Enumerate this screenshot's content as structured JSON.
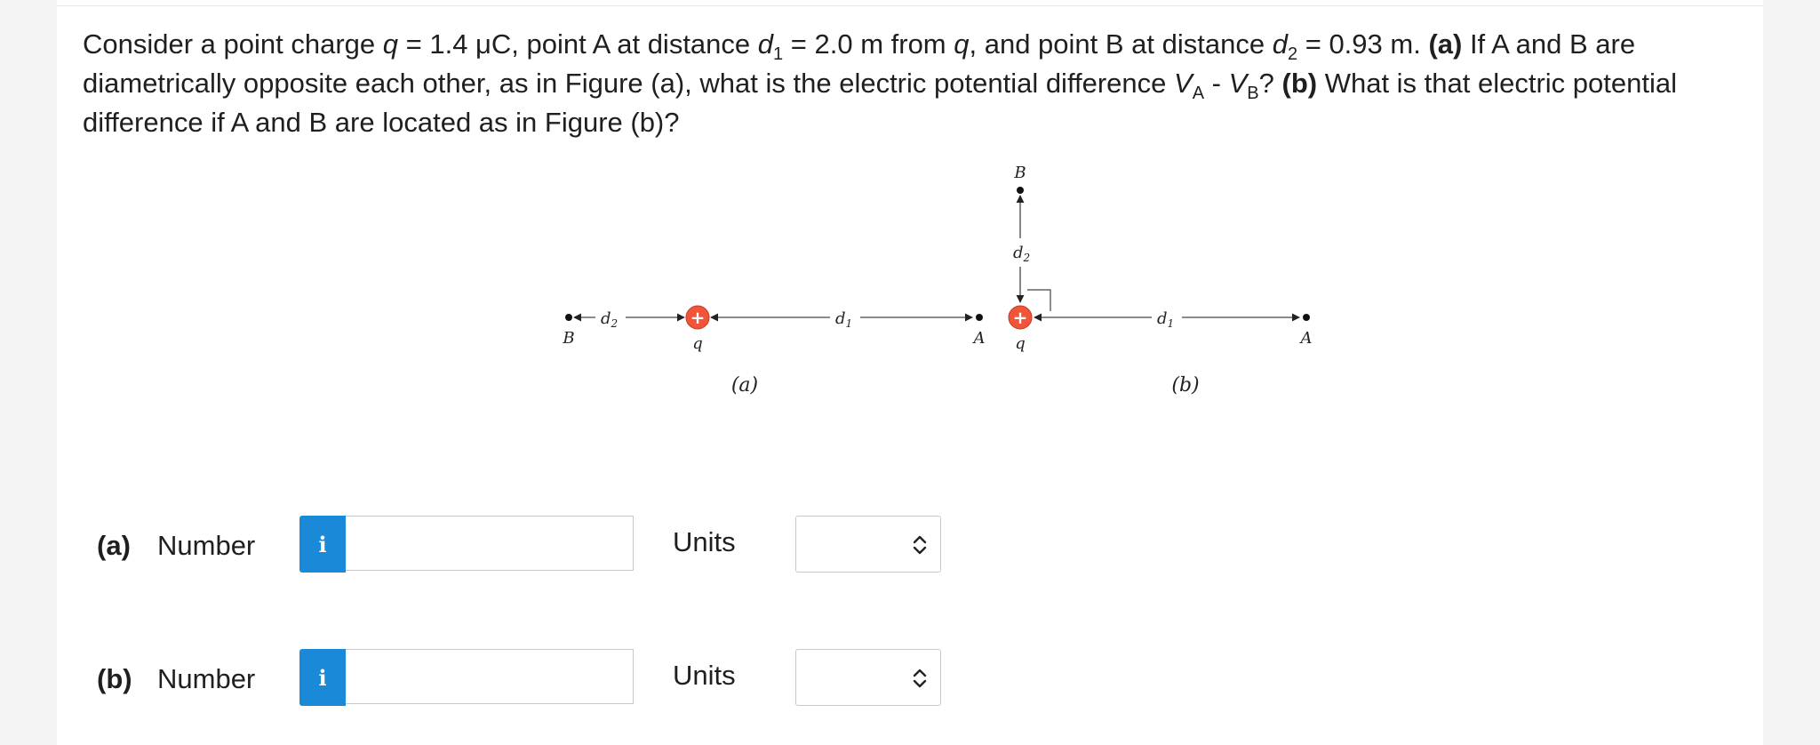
{
  "question": {
    "p1": "Consider a point charge ",
    "q_sym": "q",
    "p2": " = 1.4 μC, point A at distance ",
    "d1_sym": "d",
    "d1_sub": "1",
    "p3": " = 2.0 m from ",
    "q_sym2": "q",
    "p4": ", and point B at distance ",
    "d2_sym": "d",
    "d2_sub": "2",
    "p5": " = 0.93 m. ",
    "a_tag": "(a)",
    "p6": " If A and B are diametrically opposite each other, as in Figure (a), what is the electric potential difference ",
    "va_sym": "V",
    "va_sub": "A",
    "minus": " - ",
    "vb_sym": "V",
    "vb_sub": "B",
    "p7": "? ",
    "b_tag": "(b)",
    "p8": " What is that electric potential difference if A and B are located as in Figure (b)?"
  },
  "figure": {
    "a": {
      "label_B": "B",
      "label_d2": "d",
      "sub2": "2",
      "label_d1": "d",
      "sub1": "1",
      "label_q": "q",
      "label_A": "A",
      "caption": "(a)",
      "plus": "+"
    },
    "b": {
      "label_B": "B",
      "label_d2": "d",
      "sub2": "2",
      "label_d1": "d",
      "sub1": "1",
      "label_q": "q",
      "label_A": "A",
      "caption": "(b)",
      "plus": "+"
    },
    "charge_color": "#f0553a"
  },
  "answers": [
    {
      "tag": "(a)",
      "word": "Number",
      "info": "i",
      "value": "",
      "units_label": "Units",
      "units_value": ""
    },
    {
      "tag": "(b)",
      "word": "Number",
      "info": "i",
      "value": "",
      "units_label": "Units",
      "units_value": ""
    }
  ]
}
